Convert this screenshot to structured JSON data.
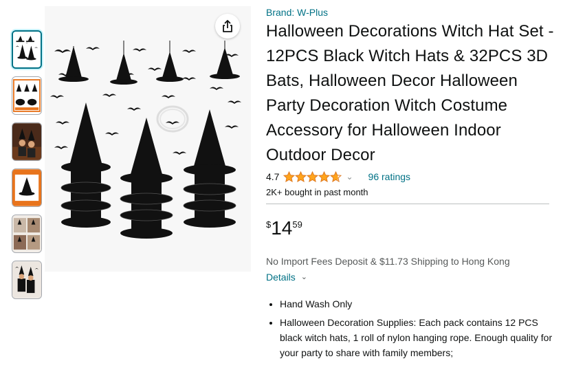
{
  "brand_label": "Brand: W-Plus",
  "title": "Halloween Decorations Witch Hat Set - 12PCS Black Witch Hats & 32PCS 3D Bats, Halloween Decor Halloween Party Decoration Witch Costume Accessory for Halloween Indoor Outdoor Decor",
  "rating": {
    "value": "4.7",
    "stars": 4.7,
    "count_text": "96 ratings",
    "star_color": "#ffa41c"
  },
  "bought_text": "2K+ bought in past month",
  "price": {
    "symbol": "$",
    "whole": "14",
    "fraction": "59"
  },
  "shipping_text": "No Import Fees Deposit & $11.73 Shipping to Hong Kong",
  "details_label": "Details",
  "bullets": [
    "Hand Wash Only",
    "Halloween Decoration Supplies: Each pack contains 12 PCS black witch hats, 1 roll of nylon hanging rope. Enough quality for your party to share with family members;"
  ],
  "thumbnails_count": 6,
  "colors": {
    "link": "#007185",
    "text": "#0f1111",
    "muted": "#565959"
  },
  "icons": {
    "share": "share-icon",
    "star": "star-icon",
    "chevron": "chevron-down-icon"
  }
}
